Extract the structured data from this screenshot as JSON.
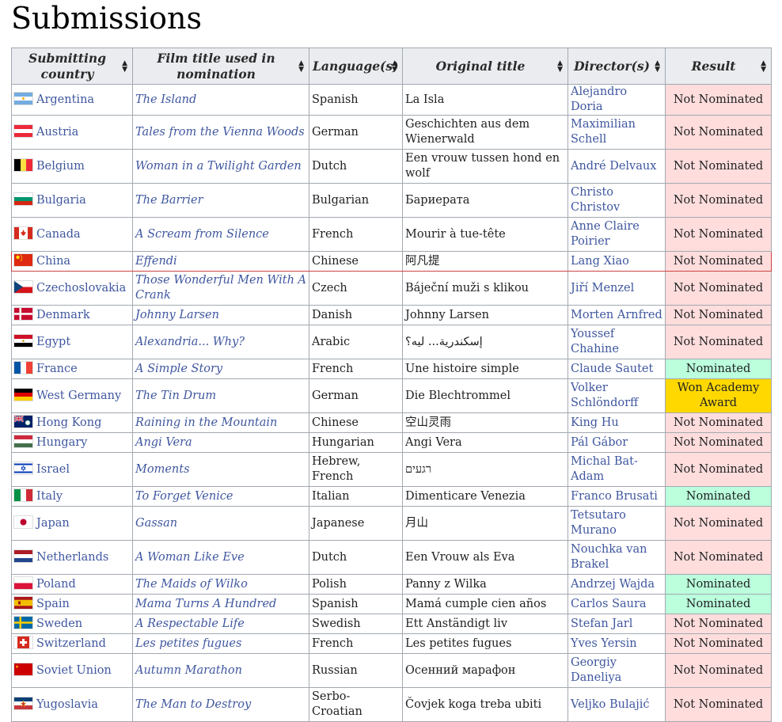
{
  "page": {
    "heading": "Submissions"
  },
  "columns": [
    "Submitting country",
    "Film title used in nomination",
    "Language(s)",
    "Original title",
    "Director(s)",
    "Result"
  ],
  "rows": [
    {
      "country": "Argentina",
      "flag": "argentina",
      "film": "The Island",
      "language": "Spanish",
      "original": "La Isla",
      "director": "Alejandro Doria",
      "result": "Not Nominated",
      "status": "nn",
      "h": 25
    },
    {
      "country": "Austria",
      "flag": "austria",
      "film": "Tales from the Vienna Woods",
      "language": "German",
      "original": "Geschichten aus dem Wienerwald",
      "director": "Maximilian Schell",
      "result": "Not Nominated",
      "status": "nn",
      "h": 43
    },
    {
      "country": "Belgium",
      "flag": "belgium",
      "film": "Woman in a Twilight Garden",
      "language": "Dutch",
      "original": "Een vrouw tussen hond en wolf",
      "director": "André Delvaux",
      "result": "Not Nominated",
      "status": "nn",
      "h": 43
    },
    {
      "country": "Bulgaria",
      "flag": "bulgaria",
      "film": "The Barrier",
      "language": "Bulgarian",
      "original": "Бариерата",
      "director": "Christo Christov",
      "result": "Not Nominated",
      "status": "nn",
      "h": 43
    },
    {
      "country": "Canada",
      "flag": "canada",
      "film": "A Scream from Silence",
      "language": "French",
      "original": "Mourir à tue-tête",
      "director": "Anne Claire Poirier",
      "result": "Not Nominated",
      "status": "nn",
      "h": 43
    },
    {
      "country": "China",
      "flag": "china",
      "film": "Effendi",
      "language": "Chinese",
      "original": "阿凡提",
      "director": "Lang Xiao",
      "result": "Not Nominated",
      "status": "nn",
      "h": 25,
      "highlight": true
    },
    {
      "country": "Czechoslovakia",
      "flag": "czechoslovakia",
      "film": "Those Wonderful Men With A Crank",
      "language": "Czech",
      "original": "Báječní muži s klikou",
      "director": "Jiří Menzel",
      "result": "Not Nominated",
      "status": "nn",
      "h": 43
    },
    {
      "country": "Denmark",
      "flag": "denmark",
      "film": "Johnny Larsen",
      "language": "Danish",
      "original": "Johnny Larsen",
      "director": "Morten Arnfred",
      "result": "Not Nominated",
      "status": "nn",
      "h": 25
    },
    {
      "country": "Egypt",
      "flag": "egypt",
      "film": "Alexandria... Why?",
      "language": "Arabic",
      "original": "إسكندرية... ليه؟",
      "director": "Youssef Chahine",
      "result": "Not Nominated",
      "status": "nn",
      "h": 43
    },
    {
      "country": "France",
      "flag": "france",
      "film": "A Simple Story",
      "language": "French",
      "original": "Une histoire simple",
      "director": "Claude Sautet",
      "result": "Nominated",
      "status": "nom",
      "h": 25
    },
    {
      "country": "West Germany",
      "flag": "germany",
      "film": "The Tin Drum",
      "language": "German",
      "original": "Die Blechtrommel",
      "director": "Volker Schlöndorff",
      "result": "Won Academy Award",
      "status": "won",
      "h": 43
    },
    {
      "country": "Hong Kong",
      "flag": "hongkong",
      "film": "Raining in the Mountain",
      "language": "Chinese",
      "original": "空山灵雨",
      "director": "King Hu",
      "result": "Not Nominated",
      "status": "nn",
      "h": 25
    },
    {
      "country": "Hungary",
      "flag": "hungary",
      "film": "Angi Vera",
      "language": "Hungarian",
      "original": "Angi Vera",
      "director": "Pál Gábor",
      "result": "Not Nominated",
      "status": "nn",
      "h": 25
    },
    {
      "country": "Israel",
      "flag": "israel",
      "film": "Moments",
      "language": "Hebrew, French",
      "original": "רגעים",
      "director": "Michal Bat-Adam",
      "result": "Not Nominated",
      "status": "nn",
      "h": 43
    },
    {
      "country": "Italy",
      "flag": "italy",
      "film": "To Forget Venice",
      "language": "Italian",
      "original": "Dimenticare Venezia",
      "director": "Franco Brusati",
      "result": "Nominated",
      "status": "nom",
      "h": 25
    },
    {
      "country": "Japan",
      "flag": "japan",
      "film": "Gassan",
      "language": "Japanese",
      "original": "月山",
      "director": "Tetsutaro Murano",
      "result": "Not Nominated",
      "status": "nn",
      "h": 43
    },
    {
      "country": "Netherlands",
      "flag": "netherlands",
      "film": "A Woman Like Eve",
      "language": "Dutch",
      "original": "Een Vrouw als Eva",
      "director": "Nouchka van Brakel",
      "result": "Not Nominated",
      "status": "nn",
      "h": 43
    },
    {
      "country": "Poland",
      "flag": "poland",
      "film": "The Maids of Wilko",
      "language": "Polish",
      "original": "Panny z Wilka",
      "director": "Andrzej Wajda",
      "result": "Nominated",
      "status": "nom",
      "h": 25
    },
    {
      "country": "Spain",
      "flag": "spain",
      "film": "Mama Turns A Hundred",
      "language": "Spanish",
      "original": "Mamá cumple cien años",
      "director": "Carlos Saura",
      "result": "Nominated",
      "status": "nom",
      "h": 25
    },
    {
      "country": "Sweden",
      "flag": "sweden",
      "film": "A Respectable Life",
      "language": "Swedish",
      "original": "Ett Anständigt liv",
      "director": "Stefan Jarl",
      "result": "Not Nominated",
      "status": "nn",
      "h": 25
    },
    {
      "country": "Switzerland",
      "flag": "switzerland",
      "film": "Les petites fugues",
      "language": "French",
      "original": "Les petites fugues",
      "director": "Yves Yersin",
      "result": "Not Nominated",
      "status": "nn",
      "h": 25
    },
    {
      "country": "Soviet Union",
      "flag": "ussr",
      "film": "Autumn Marathon",
      "language": "Russian",
      "original": "Осенний марафон",
      "director": "Georgiy Daneliya",
      "result": "Not Nominated",
      "status": "nn",
      "h": 43
    },
    {
      "country": "Yugoslavia",
      "flag": "yugoslavia",
      "film": "The Man to Destroy",
      "language": "Serbo-Croatian",
      "original": "Čovjek koga treba ubiti",
      "director": "Veljko Bulajić",
      "result": "Not Nominated",
      "status": "nn",
      "h": 43
    }
  ]
}
